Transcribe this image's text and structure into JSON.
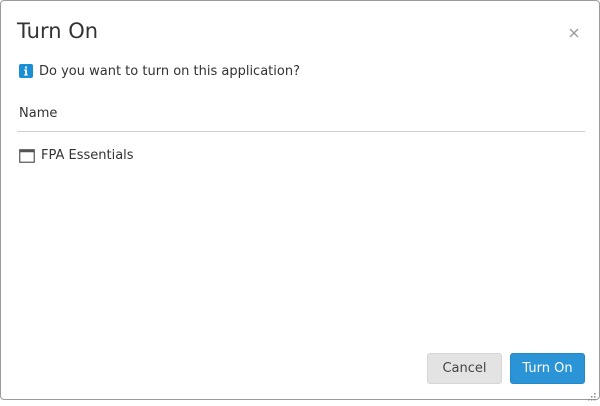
{
  "dialog": {
    "title": "Turn On",
    "message": "Do you want to turn on this application?",
    "icons": {
      "info": "info-icon",
      "close": "close-icon",
      "item": "window-icon",
      "resize": "resize-grip-icon"
    }
  },
  "list": {
    "column_header": "Name",
    "items": [
      {
        "label": "FPA Essentials"
      }
    ]
  },
  "buttons": {
    "cancel_label": "Cancel",
    "confirm_label": "Turn On"
  },
  "colors": {
    "accent": "#2a94d6",
    "info": "#1a8fd6",
    "cancel_bg": "#e3e3e3",
    "border": "#9a9a9a",
    "divider": "#d0d0d0"
  }
}
